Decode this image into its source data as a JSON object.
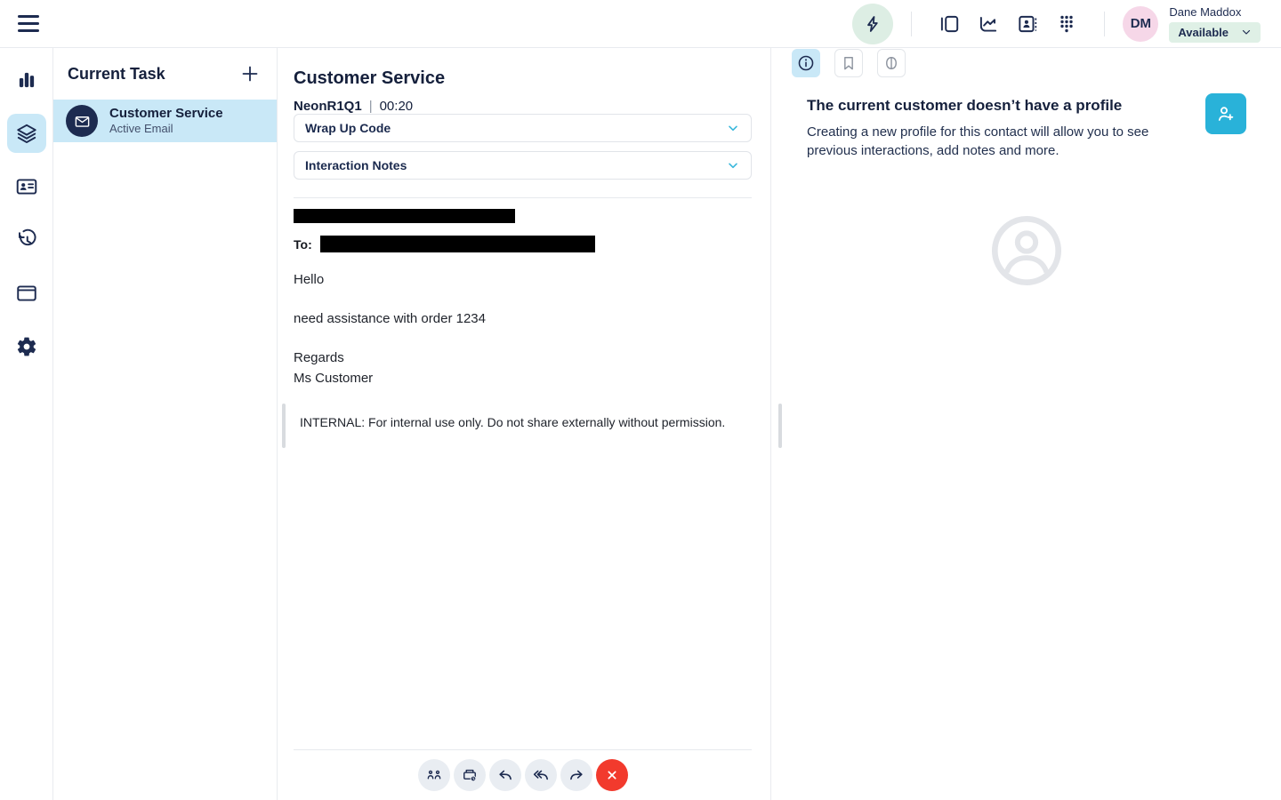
{
  "header": {
    "user_name": "Dane Maddox",
    "user_initials": "DM",
    "status": "Available"
  },
  "tasks": {
    "title": "Current Task",
    "items": [
      {
        "title": "Customer Service",
        "subtitle": "Active Email"
      }
    ]
  },
  "interaction": {
    "title": "Customer Service",
    "queue": "NeonR1Q1",
    "separator": "|",
    "timer": "00:20",
    "sections": [
      {
        "label": "Wrap Up Code"
      },
      {
        "label": "Interaction Notes"
      }
    ],
    "email": {
      "to_label": "To:",
      "greeting": "Hello",
      "body": "need assistance with order 1234",
      "signoff": "Regards",
      "signature": "Ms Customer",
      "internal_note": "INTERNAL: For internal use only. Do not share externally without permission."
    }
  },
  "profile": {
    "heading": "The current customer doesn’t have a profile",
    "description": "Creating a new profile for this contact will allow you to see previous interactions, add notes and more."
  },
  "colors": {
    "accent_navy": "#1d2b50",
    "highlight_blue": "#c9e8f7",
    "accent_teal": "#29b2d9",
    "status_green_bg": "#dff0e6",
    "avatar_pink": "#f6d7e8",
    "end_red": "#f23a2d"
  }
}
